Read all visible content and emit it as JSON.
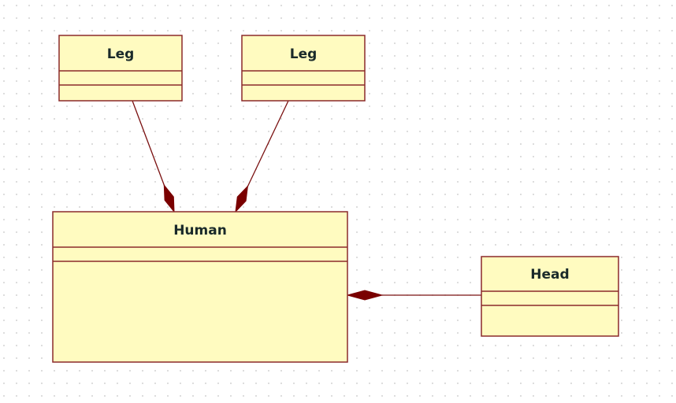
{
  "diagram_type": "UML class diagram",
  "colors": {
    "class_fill": "#fffbc0",
    "class_border": "#8b2a2a",
    "link": "#7a0000"
  },
  "classes": [
    {
      "name": "Leg"
    },
    {
      "name": "Leg"
    },
    {
      "name": "Human"
    },
    {
      "name": "Head"
    }
  ],
  "relationships": [
    {
      "type": "composition",
      "whole": "Human",
      "part": "Leg"
    },
    {
      "type": "composition",
      "whole": "Human",
      "part": "Leg"
    },
    {
      "type": "composition",
      "whole": "Human",
      "part": "Head"
    }
  ]
}
